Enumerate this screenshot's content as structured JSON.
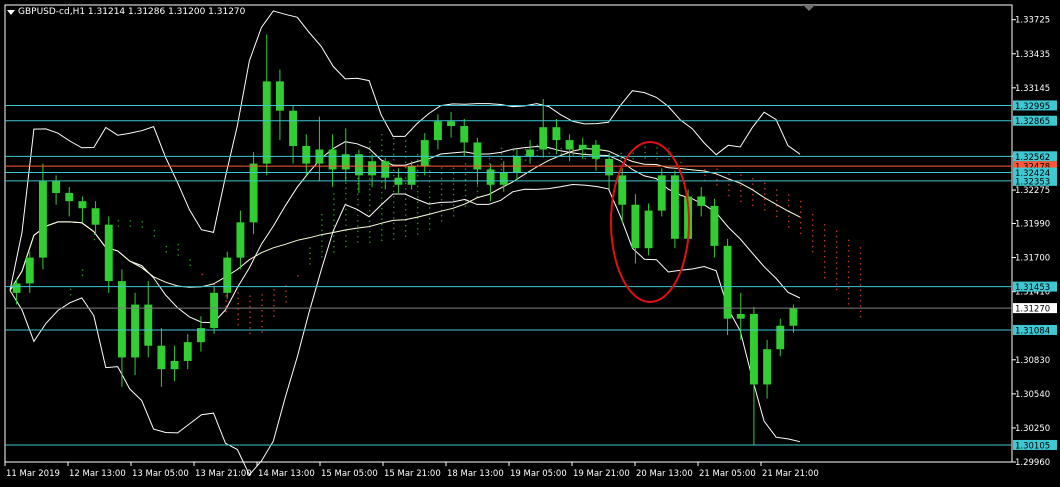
{
  "window": {
    "title": "GBPUSD-cd,H1  1.31214 1.31286 1.31200 1.31270"
  },
  "colors": {
    "background": "#000000",
    "axis": "#ffffff",
    "candle": "#32cd32",
    "bollinger": "#ffffff",
    "moving_average": "#ffffe0",
    "cloud_bull": "#2e8b2e",
    "cloud_bear": "#c0392b",
    "level_line": "#3fc7d2",
    "level_badge": "#3fc7d2",
    "resistance_line": "#ff5a36",
    "price_badge": "#ffffff",
    "annotation": "#e01010"
  },
  "chart_data": {
    "type": "line",
    "ylim": [
      1.2996,
      1.3385
    ],
    "y_ticks": [
      "1.33725",
      "1.33435",
      "1.33145",
      "1.32565",
      "1.32275",
      "1.31990",
      "1.31700",
      "1.31410",
      "1.30830",
      "1.30540",
      "1.30250",
      "1.29960"
    ],
    "x_ticks": [
      "11 Mar 2019",
      "12 Mar 13:00",
      "13 Mar 05:00",
      "13 Mar 21:00",
      "14 Mar 13:00",
      "15 Mar 05:00",
      "15 Mar 21:00",
      "18 Mar 13:00",
      "19 Mar 05:00",
      "19 Mar 21:00",
      "20 Mar 13:00",
      "21 Mar 05:00",
      "21 Mar 21:00"
    ],
    "horizontal_levels": [
      {
        "label": "1.32995",
        "value": 1.32995,
        "kind": "level"
      },
      {
        "label": "1.32865",
        "value": 1.32865,
        "kind": "level"
      },
      {
        "label": "1.32562",
        "value": 1.32562,
        "kind": "level"
      },
      {
        "label": "1.32478",
        "value": 1.32478,
        "kind": "resistance"
      },
      {
        "label": "1.32424",
        "value": 1.32424,
        "kind": "level"
      },
      {
        "label": "1.32353",
        "value": 1.32353,
        "kind": "level"
      },
      {
        "label": "1.31453",
        "value": 1.31453,
        "kind": "level"
      },
      {
        "label": "1.31084",
        "value": 1.31084,
        "kind": "level"
      },
      {
        "label": "1.30105",
        "value": 1.30105,
        "kind": "level"
      }
    ],
    "last_price": {
      "label": "1.31270",
      "value": 1.3127
    },
    "price_path": [
      [
        0,
        1.3142
      ],
      [
        2,
        1.3175
      ],
      [
        4,
        1.325
      ],
      [
        6,
        1.322
      ],
      [
        8,
        1.3215
      ],
      [
        10,
        1.32
      ],
      [
        12,
        1.3195
      ],
      [
        14,
        1.314
      ],
      [
        16,
        1.307
      ],
      [
        18,
        1.315
      ],
      [
        20,
        1.308
      ],
      [
        22,
        1.31
      ],
      [
        24,
        1.306
      ],
      [
        26,
        1.309
      ],
      [
        28,
        1.31
      ],
      [
        30,
        1.313
      ],
      [
        32,
        1.315
      ],
      [
        34,
        1.319
      ],
      [
        36,
        1.326
      ],
      [
        38,
        1.328
      ],
      [
        40,
        1.3335
      ],
      [
        42,
        1.33
      ],
      [
        44,
        1.327
      ],
      [
        46,
        1.325
      ],
      [
        48,
        1.3265
      ],
      [
        50,
        1.324
      ],
      [
        52,
        1.326
      ],
      [
        54,
        1.324
      ],
      [
        56,
        1.3255
      ],
      [
        58,
        1.324
      ],
      [
        60,
        1.3235
      ],
      [
        62,
        1.323
      ],
      [
        64,
        1.325
      ],
      [
        66,
        1.327
      ],
      [
        68,
        1.3285
      ],
      [
        70,
        1.329
      ],
      [
        72,
        1.3285
      ],
      [
        74,
        1.327
      ],
      [
        76,
        1.325
      ],
      [
        78,
        1.3235
      ],
      [
        80,
        1.324
      ],
      [
        82,
        1.325
      ],
      [
        84,
        1.326
      ],
      [
        86,
        1.3265
      ],
      [
        88,
        1.328
      ],
      [
        90,
        1.3275
      ],
      [
        92,
        1.326
      ],
      [
        94,
        1.3265
      ],
      [
        96,
        1.3255
      ],
      [
        98,
        1.3245
      ],
      [
        100,
        1.323
      ],
      [
        102,
        1.319
      ],
      [
        104,
        1.317
      ],
      [
        106,
        1.32
      ],
      [
        108,
        1.324
      ],
      [
        110,
        1.318
      ],
      [
        112,
        1.322
      ],
      [
        114,
        1.3225
      ],
      [
        116,
        1.321
      ],
      [
        118,
        1.318
      ],
      [
        120,
        1.311
      ],
      [
        122,
        1.312
      ],
      [
        124,
        1.306
      ],
      [
        126,
        1.304
      ],
      [
        128,
        1.309
      ],
      [
        130,
        1.311
      ],
      [
        132,
        1.3127
      ]
    ],
    "candles": [
      [
        0,
        1.314,
        1.3148,
        1.313,
        1.3152
      ],
      [
        1,
        1.3148,
        1.317,
        1.314,
        1.3175
      ],
      [
        2,
        1.317,
        1.3235,
        1.316,
        1.325
      ],
      [
        3,
        1.3235,
        1.3225,
        1.3215,
        1.324
      ],
      [
        4,
        1.3225,
        1.3218,
        1.3205,
        1.323
      ],
      [
        5,
        1.3218,
        1.3212,
        1.32,
        1.3222
      ],
      [
        6,
        1.3212,
        1.3198,
        1.319,
        1.3218
      ],
      [
        7,
        1.3198,
        1.315,
        1.314,
        1.3205
      ],
      [
        8,
        1.315,
        1.3085,
        1.306,
        1.316
      ],
      [
        9,
        1.3085,
        1.313,
        1.307,
        1.314
      ],
      [
        10,
        1.313,
        1.3095,
        1.3085,
        1.315
      ],
      [
        11,
        1.3095,
        1.3075,
        1.306,
        1.311
      ],
      [
        12,
        1.3075,
        1.3082,
        1.3065,
        1.3095
      ],
      [
        13,
        1.3082,
        1.3098,
        1.3075,
        1.3105
      ],
      [
        14,
        1.3098,
        1.311,
        1.309,
        1.312
      ],
      [
        15,
        1.311,
        1.314,
        1.3105,
        1.3145
      ],
      [
        16,
        1.314,
        1.317,
        1.3135,
        1.3175
      ],
      [
        17,
        1.317,
        1.32,
        1.316,
        1.321
      ],
      [
        18,
        1.32,
        1.325,
        1.319,
        1.326
      ],
      [
        19,
        1.325,
        1.332,
        1.324,
        1.336
      ],
      [
        20,
        1.332,
        1.3295,
        1.327,
        1.333
      ],
      [
        21,
        1.3295,
        1.3265,
        1.325,
        1.33
      ],
      [
        22,
        1.3265,
        1.325,
        1.324,
        1.3275
      ],
      [
        23,
        1.325,
        1.3262,
        1.3235,
        1.329
      ],
      [
        24,
        1.3262,
        1.3245,
        1.323,
        1.3275
      ],
      [
        25,
        1.3245,
        1.3258,
        1.3235,
        1.328
      ],
      [
        26,
        1.3258,
        1.324,
        1.3225,
        1.3262
      ],
      [
        27,
        1.324,
        1.3252,
        1.323,
        1.3258
      ],
      [
        28,
        1.3252,
        1.3238,
        1.3228,
        1.3255
      ],
      [
        29,
        1.3238,
        1.3232,
        1.3225,
        1.3246
      ],
      [
        30,
        1.3232,
        1.3248,
        1.3228,
        1.3252
      ],
      [
        31,
        1.3248,
        1.327,
        1.324,
        1.3276
      ],
      [
        32,
        1.327,
        1.3286,
        1.3262,
        1.3292
      ],
      [
        33,
        1.3286,
        1.3282,
        1.3272,
        1.3294
      ],
      [
        34,
        1.3282,
        1.3268,
        1.3256,
        1.3288
      ],
      [
        35,
        1.3268,
        1.3245,
        1.3232,
        1.3272
      ],
      [
        36,
        1.3245,
        1.3232,
        1.3218,
        1.325
      ],
      [
        37,
        1.3232,
        1.3242,
        1.3226,
        1.3252
      ],
      [
        38,
        1.3242,
        1.3256,
        1.3236,
        1.3262
      ],
      [
        39,
        1.3256,
        1.3262,
        1.325,
        1.327
      ],
      [
        40,
        1.3262,
        1.3281,
        1.3255,
        1.3305
      ],
      [
        41,
        1.3281,
        1.327,
        1.3258,
        1.3288
      ],
      [
        42,
        1.327,
        1.3262,
        1.3252,
        1.3275
      ],
      [
        43,
        1.3262,
        1.3266,
        1.3254,
        1.3272
      ],
      [
        44,
        1.3266,
        1.3254,
        1.3244,
        1.327
      ],
      [
        45,
        1.3254,
        1.324,
        1.3228,
        1.3258
      ],
      [
        46,
        1.324,
        1.3215,
        1.32,
        1.3246
      ],
      [
        47,
        1.3215,
        1.3178,
        1.3165,
        1.3224
      ],
      [
        48,
        1.3178,
        1.321,
        1.3172,
        1.3216
      ],
      [
        49,
        1.321,
        1.324,
        1.3205,
        1.3246
      ],
      [
        50,
        1.324,
        1.3186,
        1.3178,
        1.3244
      ],
      [
        51,
        1.3186,
        1.3222,
        1.3182,
        1.3228
      ],
      [
        52,
        1.3222,
        1.3214,
        1.3205,
        1.323
      ],
      [
        53,
        1.3214,
        1.318,
        1.317,
        1.322
      ],
      [
        54,
        1.318,
        1.3118,
        1.3104,
        1.3186
      ],
      [
        55,
        1.3118,
        1.3122,
        1.31,
        1.314
      ],
      [
        56,
        1.3122,
        1.3062,
        1.301,
        1.3128
      ],
      [
        57,
        1.3062,
        1.3092,
        1.305,
        1.31
      ],
      [
        58,
        1.3092,
        1.3112,
        1.3086,
        1.3118
      ],
      [
        59,
        1.3112,
        1.3127,
        1.3106,
        1.313
      ]
    ]
  }
}
